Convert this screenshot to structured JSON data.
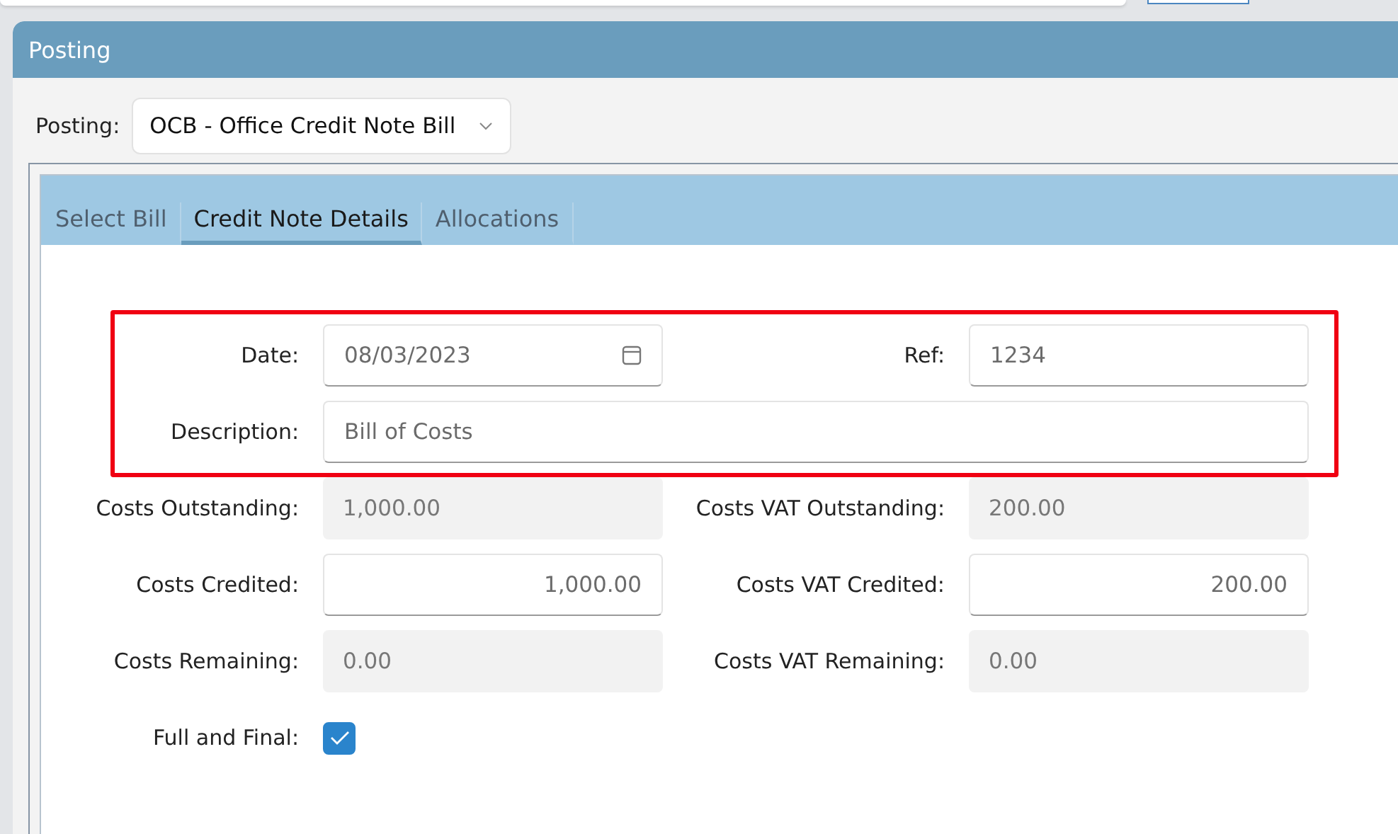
{
  "panel": {
    "title": "Posting"
  },
  "posting": {
    "label": "Posting:",
    "value": "OCB - Office Credit Note Bill"
  },
  "tabs": [
    {
      "label": "Select Bill",
      "selected": false
    },
    {
      "label": "Credit Note Details",
      "selected": true
    },
    {
      "label": "Allocations",
      "selected": false
    }
  ],
  "rows": [
    {
      "highlighted": true,
      "cells": [
        {
          "label": "Date:",
          "kind": "date",
          "value": "08/03/2023"
        },
        {
          "label": "Ref:",
          "kind": "text",
          "value": "1234"
        }
      ]
    },
    {
      "highlighted": true,
      "cells": [
        {
          "label": "Description:",
          "kind": "wide",
          "value": "Bill of Costs"
        }
      ]
    },
    {
      "highlighted": false,
      "cells": [
        {
          "label": "Costs Outstanding:",
          "kind": "readonly",
          "value": "1,000.00"
        },
        {
          "label": "Costs VAT Outstanding:",
          "kind": "readonly",
          "value": "200.00"
        }
      ]
    },
    {
      "highlighted": false,
      "cells": [
        {
          "label": "Costs Credited:",
          "kind": "amount",
          "value": "1,000.00"
        },
        {
          "label": "Costs VAT Credited:",
          "kind": "amount",
          "value": "200.00"
        }
      ]
    },
    {
      "highlighted": false,
      "cells": [
        {
          "label": "Costs Remaining:",
          "kind": "readonly",
          "value": "0.00"
        },
        {
          "label": "Costs VAT Remaining:",
          "kind": "readonly",
          "value": "0.00"
        }
      ]
    },
    {
      "highlighted": false,
      "cells": [
        {
          "label": "Full and Final:",
          "kind": "checkbox",
          "checked": true
        }
      ]
    }
  ]
}
